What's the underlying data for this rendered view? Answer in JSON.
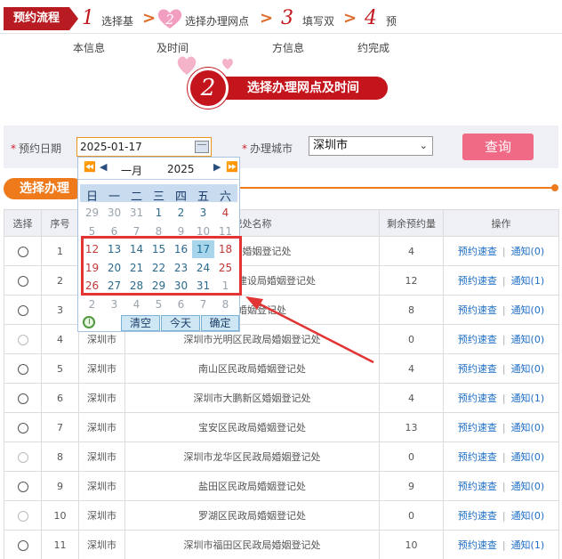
{
  "steps": {
    "label": "预约流程",
    "items": [
      {
        "num": "1",
        "line1": "选择基",
        "line2": "本信息"
      },
      {
        "num": "2",
        "line1": "选择办理网点",
        "line2": "及时间"
      },
      {
        "num": "3",
        "line1": "填写双",
        "line2": "方信息"
      },
      {
        "num": "4",
        "line1": "预",
        "line2": "约完成"
      }
    ]
  },
  "banner": {
    "num": "2",
    "text": "选择办理网点及时间"
  },
  "form": {
    "date_label": "预约日期",
    "date_value": "2025-01-17",
    "city_label": "办理城市",
    "city_value": "深圳市",
    "query_label": "查询"
  },
  "section": {
    "title": "选择办理"
  },
  "table": {
    "headers": [
      "选择",
      "序号",
      "城市",
      "登记处名称",
      "剩余预约量",
      "操作"
    ],
    "header_name_visible": "记处名称",
    "op_book": "预约速查",
    "rows": [
      {
        "no": "1",
        "city": "深圳市",
        "name": "民政局婚姻登记处",
        "remain": "4",
        "notice": "通知(0)",
        "enabled": true
      },
      {
        "no": "2",
        "city": "深圳市",
        "name": "统战和社会建设局婚姻登记处",
        "remain": "12",
        "notice": "通知(1)",
        "enabled": true
      },
      {
        "no": "3",
        "city": "深圳市",
        "name": "政局婚姻登记处",
        "remain": "8",
        "notice": "通知(0)",
        "enabled": true
      },
      {
        "no": "4",
        "city": "深圳市",
        "name": "深圳市光明区民政局婚姻登记处",
        "remain": "0",
        "notice": "通知(0)",
        "enabled": false
      },
      {
        "no": "5",
        "city": "深圳市",
        "name": "南山区民政局婚姻登记处",
        "remain": "4",
        "notice": "通知(0)",
        "enabled": true
      },
      {
        "no": "6",
        "city": "深圳市",
        "name": "深圳市大鹏新区婚姻登记处",
        "remain": "4",
        "notice": "通知(1)",
        "enabled": true
      },
      {
        "no": "7",
        "city": "深圳市",
        "name": "宝安区民政局婚姻登记处",
        "remain": "13",
        "notice": "通知(0)",
        "enabled": true
      },
      {
        "no": "8",
        "city": "深圳市",
        "name": "深圳市龙华区民政局婚姻登记处",
        "remain": "0",
        "notice": "通知(0)",
        "enabled": false
      },
      {
        "no": "9",
        "city": "深圳市",
        "name": "盐田区民政局婚姻登记处",
        "remain": "9",
        "notice": "通知(0)",
        "enabled": true
      },
      {
        "no": "10",
        "city": "深圳市",
        "name": "罗湖区民政局婚姻登记处",
        "remain": "0",
        "notice": "通知(0)",
        "enabled": false
      },
      {
        "no": "11",
        "city": "深圳市",
        "name": "深圳市福田区民政局婚姻登记处",
        "remain": "10",
        "notice": "通知(1)",
        "enabled": true
      }
    ]
  },
  "calendar": {
    "nav_prev_year": "⏪",
    "nav_prev_month": "◀",
    "nav_next_month": "▶",
    "nav_next_year": "⏩",
    "month": "一月",
    "year": "2025",
    "weekdays": [
      "日",
      "一",
      "二",
      "三",
      "四",
      "五",
      "六"
    ],
    "weeks": [
      [
        "29",
        "30",
        "31",
        "1",
        "2",
        "3",
        "4"
      ],
      [
        "5",
        "6",
        "7",
        "8",
        "9",
        "10",
        "11"
      ],
      [
        "12",
        "13",
        "14",
        "15",
        "16",
        "17",
        "18"
      ],
      [
        "19",
        "20",
        "21",
        "22",
        "23",
        "24",
        "25"
      ],
      [
        "26",
        "27",
        "28",
        "29",
        "30",
        "31",
        "1"
      ],
      [
        "2",
        "3",
        "4",
        "5",
        "6",
        "7",
        "8"
      ]
    ],
    "selected": "17",
    "clear_label": "清空",
    "today_label": "今天",
    "ok_label": "确定"
  },
  "colors": {
    "brand_red": "#c4151c",
    "accent_orange": "#ee7a1c",
    "query_pink": "#f06a86",
    "link_blue": "#1f6fc7"
  }
}
